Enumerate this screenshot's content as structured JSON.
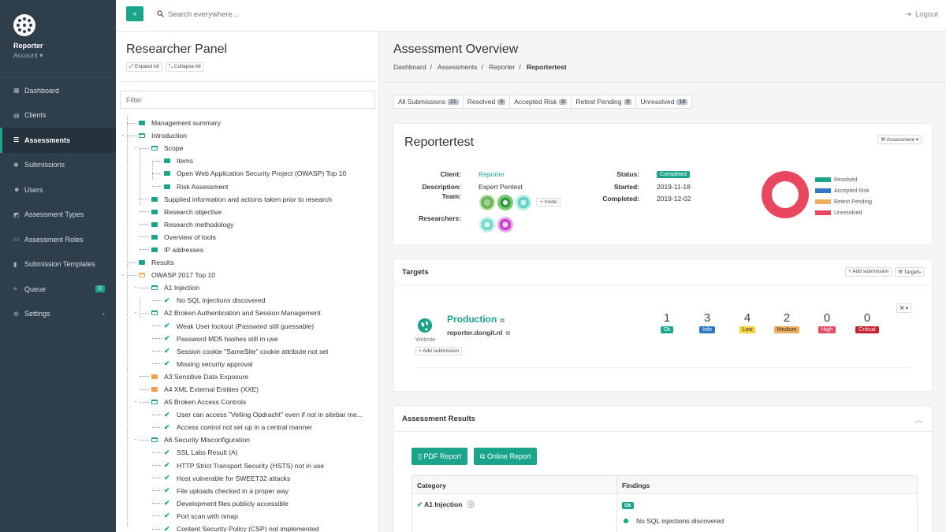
{
  "brand": {
    "name": "Reporter",
    "account": "Account ▾"
  },
  "nav": [
    {
      "label": "Dashboard",
      "icon": "dashboard-icon",
      "glyph": "▦"
    },
    {
      "label": "Clients",
      "icon": "clients-icon",
      "glyph": "▤"
    },
    {
      "label": "Assessments",
      "icon": "list-icon",
      "glyph": "☰",
      "active": true
    },
    {
      "label": "Submissions",
      "icon": "bug-icon",
      "glyph": "✱"
    },
    {
      "label": "Users",
      "icon": "users-icon",
      "glyph": "☻"
    },
    {
      "label": "Assessment Types",
      "icon": "tag-icon",
      "glyph": "◩"
    },
    {
      "label": "Assessment Roles",
      "icon": "id-card-icon",
      "glyph": "▭"
    },
    {
      "label": "Submission Templates",
      "icon": "file-icon",
      "glyph": "▮"
    },
    {
      "label": "Queue",
      "icon": "database-icon",
      "glyph": "≡",
      "badge": "0"
    },
    {
      "label": "Settings",
      "icon": "cogs-icon",
      "glyph": "⚙",
      "chevron": "‹"
    }
  ],
  "topbar": {
    "collapse": "«",
    "search_placeholder": "Search everywhere...",
    "logout": "Logout"
  },
  "researcher": {
    "title": "Researcher Panel",
    "expand_all": "Expand All",
    "collapse_all": "Collapse All",
    "filter_placeholder": "Filter",
    "tree": [
      {
        "label": "Management summary",
        "level": 0,
        "type": "folder"
      },
      {
        "label": "Introduction",
        "level": 0,
        "type": "open"
      },
      {
        "label": "Scope",
        "level": 1,
        "type": "open"
      },
      {
        "label": "Items",
        "level": 2,
        "type": "folder"
      },
      {
        "label": "Open Web Application Security Project (OWASP) Top 10",
        "level": 2,
        "type": "folder"
      },
      {
        "label": "Risk Assessment",
        "level": 2,
        "type": "folder"
      },
      {
        "label": "Supplied information and actions taken prior to research",
        "level": 1,
        "type": "folder"
      },
      {
        "label": "Research objective",
        "level": 1,
        "type": "folder"
      },
      {
        "label": "Research methodology",
        "level": 1,
        "type": "folder"
      },
      {
        "label": "Overview of tools",
        "level": 1,
        "type": "folder"
      },
      {
        "label": "IP addresses",
        "level": 1,
        "type": "folder"
      },
      {
        "label": "Results",
        "level": 0,
        "type": "folder"
      },
      {
        "label": "OWASP 2017 Top 10",
        "level": 0,
        "type": "open-orange"
      },
      {
        "label": "A1 Injection",
        "level": 1,
        "type": "open"
      },
      {
        "label": "No SQL injections discovered",
        "level": 2,
        "type": "check"
      },
      {
        "label": "A2 Broken Authentication and Session Management",
        "level": 1,
        "type": "open"
      },
      {
        "label": "Weak User lockout (Password still guessable)",
        "level": 2,
        "type": "check"
      },
      {
        "label": "Password MD5 hashes still in use",
        "level": 2,
        "type": "check"
      },
      {
        "label": "Session cookie \"SameSite\" cookie attribute not set",
        "level": 2,
        "type": "check"
      },
      {
        "label": "Missing security approval",
        "level": 2,
        "type": "check"
      },
      {
        "label": "A3 Sensitive Data Exposure",
        "level": 1,
        "type": "orange"
      },
      {
        "label": "A4 XML External Entities (XXE)",
        "level": 1,
        "type": "orange"
      },
      {
        "label": "A5 Broken Access Controls",
        "level": 1,
        "type": "open"
      },
      {
        "label": "User can access \"Veiling Opdracht\" even if not in sitebar me...",
        "level": 2,
        "type": "check"
      },
      {
        "label": "Access control not set up in a central manner",
        "level": 2,
        "type": "check"
      },
      {
        "label": "A6 Security Misconfiguration",
        "level": 1,
        "type": "open"
      },
      {
        "label": "SSL Labs Result (A)",
        "level": 2,
        "type": "check"
      },
      {
        "label": "HTTP Strict Transport Security (HSTS) not in use",
        "level": 2,
        "type": "check"
      },
      {
        "label": "Host vulnerable for SWEET32 attacks",
        "level": 2,
        "type": "check"
      },
      {
        "label": "File uploads checked in a proper way",
        "level": 2,
        "type": "check"
      },
      {
        "label": "Development files publicly accessible",
        "level": 2,
        "type": "check"
      },
      {
        "label": "Port scan with nmap",
        "level": 2,
        "type": "check"
      },
      {
        "label": "Content Security Policy (CSP) not implemented",
        "level": 2,
        "type": "check"
      }
    ]
  },
  "main": {
    "title": "Assessment Overview",
    "breadcrumb": [
      "Dashboard",
      "Assessments",
      "Reporter",
      "Reportertest"
    ],
    "filters": [
      {
        "label": "All Submissions",
        "count": "21"
      },
      {
        "label": "Resolved",
        "count": "0"
      },
      {
        "label": "Accepted Risk",
        "count": "0"
      },
      {
        "label": "Retest Pending",
        "count": "0"
      },
      {
        "label": "Unresolved",
        "count": "18"
      }
    ],
    "assessment": {
      "name": "Reportertest",
      "menu_button": "Assessment ▾",
      "client_label": "Client:",
      "client": "Reporter",
      "description_label": "Description:",
      "description": "Expert Pentest",
      "team_label": "Team:",
      "invite": "Invite",
      "researchers_label": "Researchers:",
      "status_label": "Status:",
      "status": "Completed",
      "started_label": "Started:",
      "started": "2019-11-18",
      "completed_label": "Completed:",
      "completed": "2019-12-02"
    },
    "chart_data": {
      "type": "pie",
      "categories": [
        "Resolved",
        "Accepted Risk",
        "Retest Pending",
        "Unresolved"
      ],
      "values": [
        0,
        0,
        0,
        18
      ],
      "colors": [
        "#1aa58b",
        "#2f78c4",
        "#f0ad5e",
        "#e8475f"
      ],
      "legend": "right"
    },
    "targets": {
      "title": "Targets",
      "add_submission": "Add submission",
      "targets_btn": "Targets",
      "target_name": "Production",
      "target_host": "reporter.dongit.nl",
      "target_type": "Website",
      "target_add": "Add submission",
      "severities": [
        {
          "count": "1",
          "label": "Ok",
          "color": "#1aa58b",
          "text": "#fff"
        },
        {
          "count": "3",
          "label": "Info",
          "color": "#2f78c4",
          "text": "#fff"
        },
        {
          "count": "4",
          "label": "Low",
          "color": "#f5d23c",
          "text": "#333"
        },
        {
          "count": "2",
          "label": "Medium",
          "color": "#f0ad5e",
          "text": "#333"
        },
        {
          "count": "0",
          "label": "High",
          "color": "#e8475f",
          "text": "#fff"
        },
        {
          "count": "0",
          "label": "Critical",
          "color": "#c9202f",
          "text": "#fff"
        }
      ]
    },
    "results": {
      "title": "Assessment Results",
      "pdf_report": "PDF Report",
      "online_report": "Online Report",
      "col_category": "Category",
      "col_findings": "Findings",
      "row_category": "A1 Injection",
      "row_badge": "Ok",
      "row_finding": "No SQL injections discovered"
    }
  }
}
